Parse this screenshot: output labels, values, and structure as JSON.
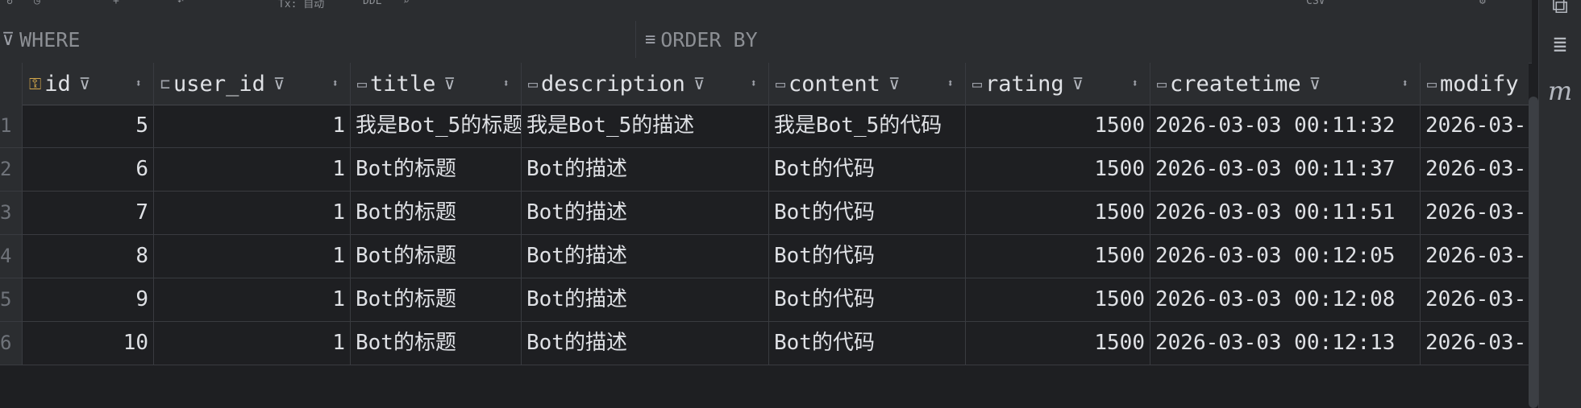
{
  "toolbar": {
    "tx_label": "Tx: 自动",
    "ddl_label": "DDL",
    "export_label": "CSV"
  },
  "filters": {
    "where_placeholder": "WHERE",
    "order_by_placeholder": "ORDER BY"
  },
  "columns": [
    {
      "name": "id",
      "icon": "primary-key-icon"
    },
    {
      "name": "user_id",
      "icon": "foreign-key-column-icon"
    },
    {
      "name": "title",
      "icon": "column-icon"
    },
    {
      "name": "description",
      "icon": "column-icon"
    },
    {
      "name": "content",
      "icon": "column-icon"
    },
    {
      "name": "rating",
      "icon": "column-icon"
    },
    {
      "name": "createtime",
      "icon": "column-icon"
    },
    {
      "name": "modify",
      "icon": "column-icon"
    }
  ],
  "rows": [
    {
      "n": "1",
      "id": "5",
      "user_id": "1",
      "title": "我是Bot_5的标题",
      "description": "我是Bot_5的描述",
      "content": "我是Bot_5的代码",
      "rating": "1500",
      "createtime": "2026-03-03 00:11:32",
      "modify": "2026-03-"
    },
    {
      "n": "2",
      "id": "6",
      "user_id": "1",
      "title": "Bot的标题",
      "description": "Bot的描述",
      "content": "Bot的代码",
      "rating": "1500",
      "createtime": "2026-03-03 00:11:37",
      "modify": "2026-03-"
    },
    {
      "n": "3",
      "id": "7",
      "user_id": "1",
      "title": "Bot的标题",
      "description": "Bot的描述",
      "content": "Bot的代码",
      "rating": "1500",
      "createtime": "2026-03-03 00:11:51",
      "modify": "2026-03-"
    },
    {
      "n": "4",
      "id": "8",
      "user_id": "1",
      "title": "Bot的标题",
      "description": "Bot的描述",
      "content": "Bot的代码",
      "rating": "1500",
      "createtime": "2026-03-03 00:12:05",
      "modify": "2026-03-"
    },
    {
      "n": "5",
      "id": "9",
      "user_id": "1",
      "title": "Bot的标题",
      "description": "Bot的描述",
      "content": "Bot的代码",
      "rating": "1500",
      "createtime": "2026-03-03 00:12:08",
      "modify": "2026-03-"
    },
    {
      "n": "6",
      "id": "10",
      "user_id": "1",
      "title": "Bot的标题",
      "description": "Bot的描述",
      "content": "Bot的代码",
      "rating": "1500",
      "createtime": "2026-03-03 00:12:13",
      "modify": "2026-03-"
    }
  ],
  "sidebar": {
    "mybatis_label": "m"
  }
}
